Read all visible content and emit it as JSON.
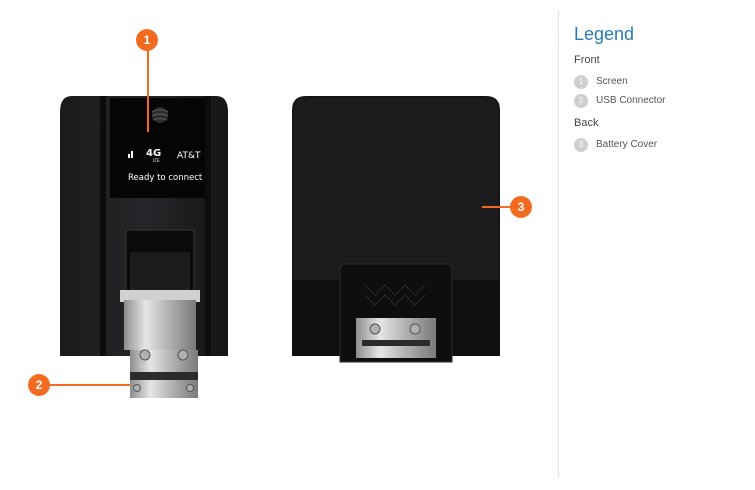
{
  "legend": {
    "title": "Legend",
    "front_label": "Front",
    "back_label": "Back",
    "front_items": [
      {
        "num": "1",
        "label": "Screen"
      },
      {
        "num": "2",
        "label": "USB Connector"
      }
    ],
    "back_items": [
      {
        "num": "3",
        "label": "Battery Cover"
      }
    ]
  },
  "callouts": {
    "c1": "1",
    "c2": "2",
    "c3": "3"
  },
  "device_screen": {
    "network": "4G",
    "network_sub": "LTE",
    "carrier": "AT&T",
    "status": "Ready to connect"
  },
  "colors": {
    "accent": "#f36b21",
    "legend_title": "#2a7ab4"
  }
}
